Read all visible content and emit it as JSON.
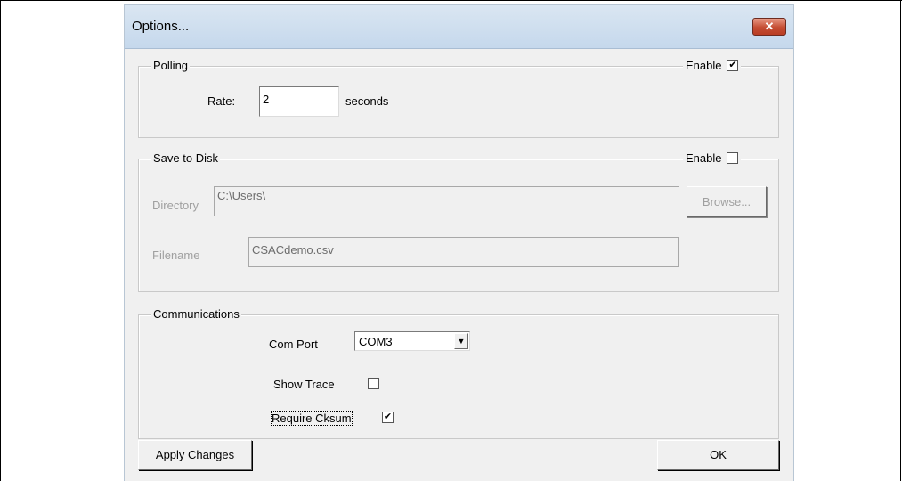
{
  "dialog": {
    "title": "Options...",
    "close_glyph": "✕"
  },
  "polling": {
    "group_label": "Polling",
    "enable_label": "Enable",
    "enable_checked": true,
    "rate_label": "Rate:",
    "rate_value": "2",
    "rate_unit": "seconds"
  },
  "save_to_disk": {
    "group_label": "Save to Disk",
    "enable_label": "Enable",
    "enable_checked": false,
    "directory_label": "Directory",
    "directory_value": "C:\\Users\\",
    "browse_label": "Browse...",
    "filename_label": "Filename",
    "filename_value": "CSACdemo.csv"
  },
  "communications": {
    "group_label": "Communications",
    "com_port_label": "Com Port",
    "com_port_value": "COM3",
    "show_trace_label": "Show Trace",
    "show_trace_checked": false,
    "require_cksum_label": "Require Cksum",
    "require_cksum_checked": true
  },
  "footer": {
    "apply_label": "Apply Changes",
    "ok_label": "OK"
  },
  "icons": {
    "check": "✔",
    "dropdown_arrow": "▼"
  }
}
